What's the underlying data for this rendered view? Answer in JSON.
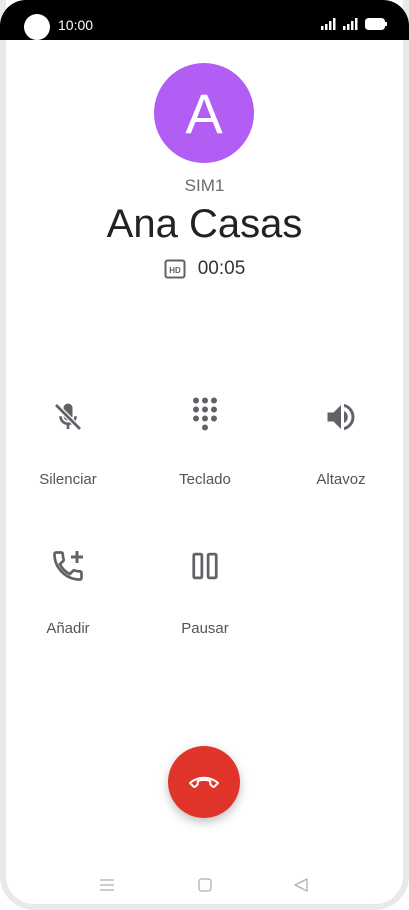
{
  "status_bar": {
    "time": "10:00"
  },
  "call": {
    "avatar_letter": "A",
    "sim": "SIM1",
    "contact_name": "Ana Casas",
    "hd_badge": "HD",
    "duration": "00:05"
  },
  "actions": [
    {
      "label": "Silenciar",
      "icon": "mic-off-icon"
    },
    {
      "label": "Teclado",
      "icon": "dialpad-icon"
    },
    {
      "label": "Altavoz",
      "icon": "speaker-icon"
    },
    {
      "label": "Añadir",
      "icon": "add-call-icon"
    },
    {
      "label": "Pausar",
      "icon": "pause-icon"
    }
  ],
  "end_call": {
    "icon": "end-call-icon",
    "color": "#e0332a"
  },
  "colors": {
    "avatar": "#b25df3",
    "end_call": "#e0332a",
    "icon_gray": "#5f6368"
  }
}
